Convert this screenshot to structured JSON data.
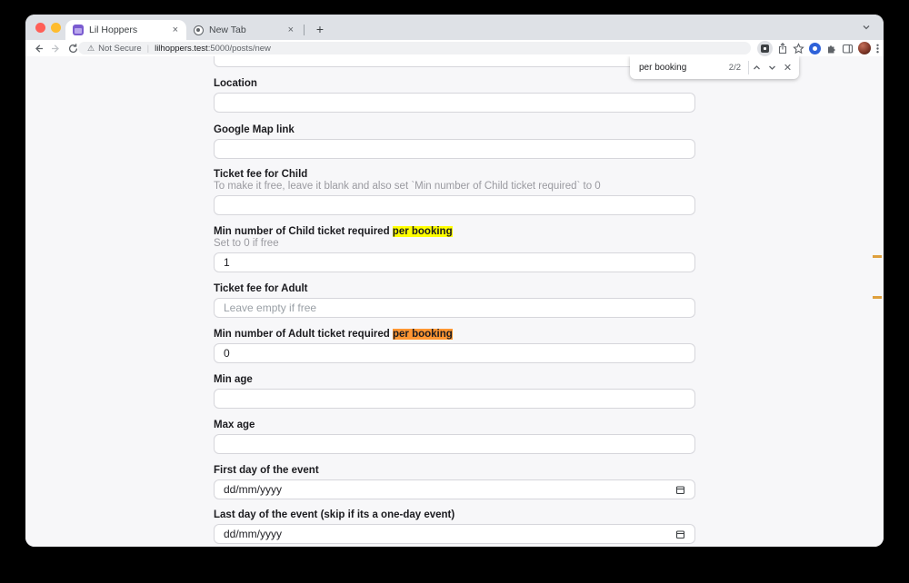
{
  "browser": {
    "tabs": [
      {
        "title": "Lil Hoppers"
      },
      {
        "title": "New Tab"
      }
    ],
    "tab_close_label": "×",
    "new_tab_button": "+",
    "address": {
      "warning_glyph": "⚠",
      "warning_text": "Not Secure",
      "separator": "|",
      "host": "lilhoppers.test",
      "path": ":5000/posts/new"
    },
    "find_bar": {
      "query": "per booking",
      "matches": "2/2"
    }
  },
  "form": {
    "fields": [
      {
        "label": "Location",
        "value": ""
      },
      {
        "label": "Google Map link",
        "value": ""
      },
      {
        "label": "Ticket fee for Child",
        "helper": "To make it free, leave it blank and also set `Min number of Child ticket required` to 0",
        "value": ""
      },
      {
        "label_prefix": "Min number of Child ticket required ",
        "highlight": "per booking",
        "helper": "Set to 0 if free",
        "value": "1"
      },
      {
        "label": "Ticket fee for Adult",
        "placeholder": "Leave empty if free",
        "value": ""
      },
      {
        "label_prefix": "Min number of Adult ticket required ",
        "highlight": "per booking",
        "value": "0"
      },
      {
        "label": "Min age",
        "value": ""
      },
      {
        "label": "Max age",
        "value": ""
      },
      {
        "label": "First day of the event",
        "value": "dd/mm/yyyy"
      },
      {
        "label": "Last day of the event (skip if its a one-day event)",
        "value": "dd/mm/yyyy"
      }
    ]
  },
  "icons": {
    "warning": "triangle-exclamation",
    "star": "☆",
    "calendar": "calendar-square",
    "find_prev": "chevron-up",
    "find_next": "chevron-down"
  },
  "colors": {
    "highlight_yellow": "#ffff00",
    "highlight_active_orange": "#ff9632",
    "favicon_purple": "#7a5bd0",
    "scroll_marker_orange": "#dfa03d",
    "tabstrip_gray": "#dee1e6",
    "page_background": "#f7f7f9"
  }
}
